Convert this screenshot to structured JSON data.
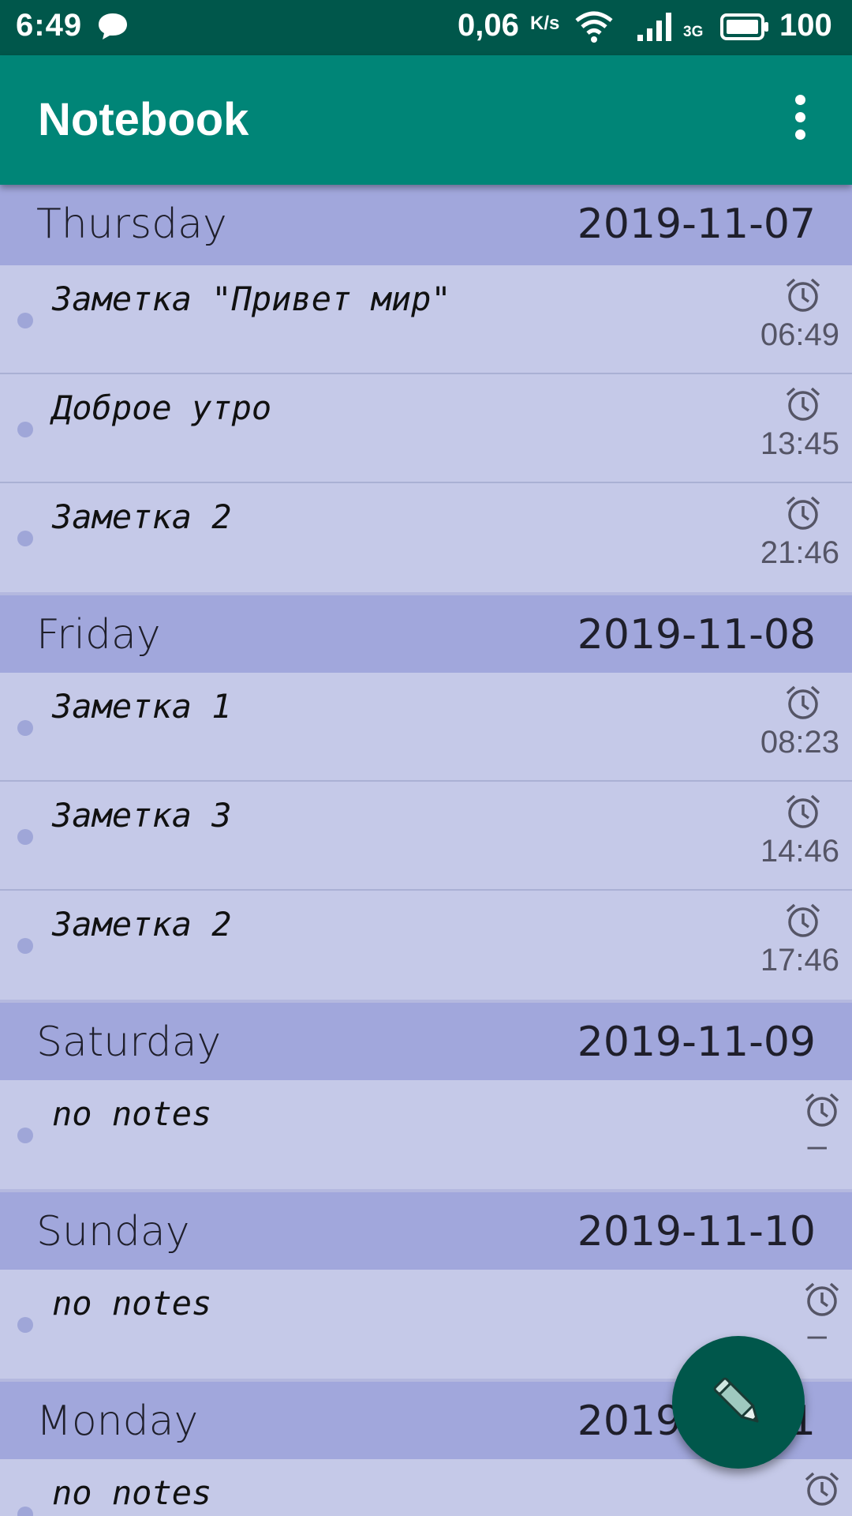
{
  "status_bar": {
    "time": "6:49",
    "speed": "0,06",
    "speed_unit": "K/s",
    "network_type": "3G",
    "battery": "100",
    "icons": [
      "message-icon",
      "wifi-icon",
      "signal-icon",
      "battery-icon"
    ]
  },
  "app_bar": {
    "title": "Notebook",
    "menu_icon": "overflow-menu-icon"
  },
  "days": [
    {
      "day": "Thursday",
      "date": "2019-11-07",
      "notes": [
        {
          "text": "Заметка \"Привет мир\"",
          "time": "06:49"
        },
        {
          "text": "Доброе утро",
          "time": "13:45"
        },
        {
          "text": "Заметка 2",
          "time": "21:46"
        }
      ]
    },
    {
      "day": "Friday",
      "date": "2019-11-08",
      "notes": [
        {
          "text": "Заметка 1",
          "time": "08:23"
        },
        {
          "text": "Заметка 3",
          "time": "14:46"
        },
        {
          "text": "Заметка 2",
          "time": "17:46"
        }
      ]
    },
    {
      "day": "Saturday",
      "date": "2019-11-09",
      "notes": [
        {
          "text": "no notes",
          "time": "–"
        }
      ]
    },
    {
      "day": "Sunday",
      "date": "2019-11-10",
      "notes": [
        {
          "text": "no notes",
          "time": "–"
        }
      ]
    },
    {
      "day": "Monday",
      "date": "2019-11-11",
      "notes": [
        {
          "text": "no notes",
          "time": ""
        }
      ]
    }
  ],
  "fab": {
    "icon": "pencil-icon"
  },
  "colors": {
    "status_bar": "#00574b",
    "app_bar": "#008577",
    "day_header": "#a1a7dc",
    "note_row": "#c5c9e8",
    "fab": "#00574b"
  }
}
